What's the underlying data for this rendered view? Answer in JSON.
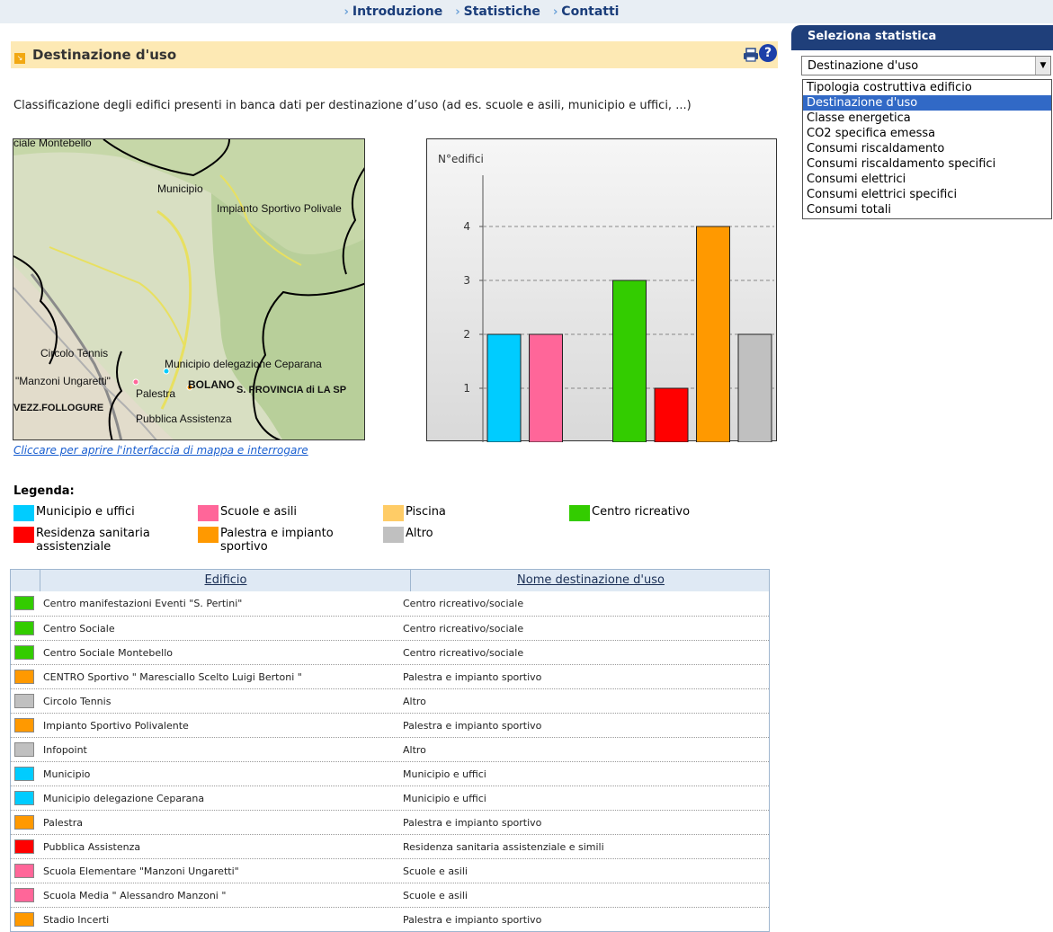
{
  "nav": {
    "items": [
      "Introduzione",
      "Statistiche",
      "Contatti"
    ]
  },
  "page": {
    "title": "Destinazione d'uso",
    "description": "Classificazione degli edifici presenti in banca dati per destinazione d’uso (ad es. scuole e asili, municipio e uffici, ...)",
    "help": "?"
  },
  "map": {
    "labels": [
      "ciale Montebello",
      "Municipio",
      "Impianto Sportivo Polivale",
      "Circolo Tennis",
      "Municipio delegazione Ceparana",
      "\"Manzoni Ungaretti\"",
      "Palestra",
      "BOLANO",
      "S. PROVINCIA di LA SP",
      "VEZZ.FOLLOGURE",
      "Pubblica Assistenza"
    ],
    "link_text": "Cliccare per aprire l'interfaccia di mappa e interrogare"
  },
  "chart_data": {
    "type": "bar",
    "ylabel": "N°edifici",
    "yticks": [
      1,
      2,
      3,
      4
    ],
    "ylim": [
      0,
      5
    ],
    "grid": true,
    "categories": [
      "Municipio e uffici",
      "Scuole e asili",
      "Piscina",
      "Centro ricreativo",
      "Residenza sanitaria assistenziale",
      "Palestra e impianto sportivo",
      "Altro"
    ],
    "values": [
      2,
      2,
      0,
      3,
      1,
      4,
      2
    ],
    "colors": [
      "#00ccff",
      "#ff6699",
      "#ffcc66",
      "#33cc00",
      "#ff0000",
      "#ff9900",
      "#c0c0c0"
    ]
  },
  "sidebar": {
    "title": "Seleziona statistica",
    "selected": "Destinazione d'uso",
    "options": [
      "Tipologia costruttiva edificio",
      "Destinazione d'uso",
      "Classe energetica",
      "CO2 specifica emessa",
      "Consumi riscaldamento",
      "Consumi riscaldamento specifici",
      "Consumi elettrici",
      "Consumi elettrici specifici",
      "Consumi totali"
    ],
    "selected_index": 1
  },
  "legend": {
    "title": "Legenda:",
    "items": [
      {
        "label": "Municipio e uffici",
        "color": "#00ccff"
      },
      {
        "label": "Scuole e asili",
        "color": "#ff6699"
      },
      {
        "label": "Piscina",
        "color": "#ffcc66"
      },
      {
        "label": "Centro ricreativo",
        "color": "#33cc00"
      },
      {
        "label": "Residenza sanitaria assistenziale",
        "color": "#ff0000"
      },
      {
        "label": "Palestra e impianto sportivo",
        "color": "#ff9900"
      },
      {
        "label": "Altro",
        "color": "#c0c0c0"
      }
    ]
  },
  "table": {
    "headers": [
      "Edificio",
      "Nome destinazione d'uso"
    ],
    "rows": [
      {
        "name": "Centro manifestazioni Eventi \"S. Pertini\"",
        "use": "Centro ricreativo/sociale",
        "color": "#33cc00"
      },
      {
        "name": "Centro Sociale",
        "use": "Centro ricreativo/sociale",
        "color": "#33cc00"
      },
      {
        "name": "Centro Sociale Montebello",
        "use": "Centro ricreativo/sociale",
        "color": "#33cc00"
      },
      {
        "name": "CENTRO Sportivo \" Maresciallo Scelto Luigi Bertoni \"",
        "use": "Palestra e impianto sportivo",
        "color": "#ff9900"
      },
      {
        "name": "Circolo Tennis",
        "use": "Altro",
        "color": "#c0c0c0"
      },
      {
        "name": "Impianto Sportivo Polivalente",
        "use": "Palestra e impianto sportivo",
        "color": "#ff9900"
      },
      {
        "name": "Infopoint",
        "use": "Altro",
        "color": "#c0c0c0"
      },
      {
        "name": "Municipio",
        "use": "Municipio e uffici",
        "color": "#00ccff"
      },
      {
        "name": "Municipio delegazione Ceparana",
        "use": "Municipio e uffici",
        "color": "#00ccff"
      },
      {
        "name": "Palestra",
        "use": "Palestra e impianto sportivo",
        "color": "#ff9900"
      },
      {
        "name": "Pubblica Assistenza",
        "use": "Residenza sanitaria assistenziale e simili",
        "color": "#ff0000"
      },
      {
        "name": "Scuola Elementare \"Manzoni Ungaretti\"",
        "use": "Scuole e asili",
        "color": "#ff6699"
      },
      {
        "name": "Scuola Media \" Alessandro Manzoni \"",
        "use": "Scuole e asili",
        "color": "#ff6699"
      },
      {
        "name": "Stadio Incerti",
        "use": "Palestra e impianto sportivo",
        "color": "#ff9900"
      }
    ]
  }
}
